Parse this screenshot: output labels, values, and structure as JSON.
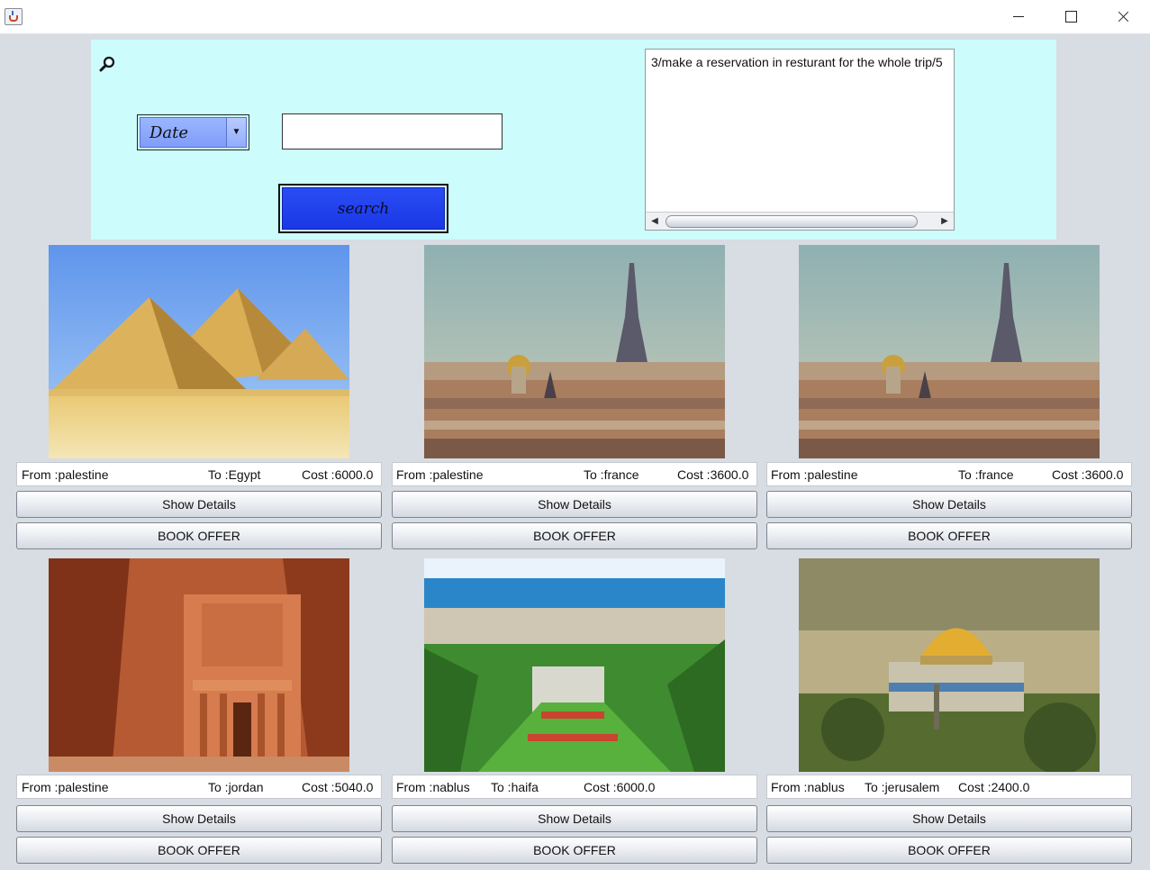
{
  "window": {
    "app_icon": "java-cup-icon",
    "controls": [
      "minimize-icon",
      "maximize-icon",
      "close-icon"
    ]
  },
  "search": {
    "icon": "magnifier-icon",
    "filter_selected": "Date",
    "query_value": "",
    "button_label": "search",
    "notes_text": "3/make a reservation in resturant for the whole trip/5"
  },
  "offers": [
    {
      "image": "pyramids-egypt",
      "from": "From :palestine",
      "to": "To :Egypt",
      "cost": "Cost :6000.0",
      "details_label": "Show Details",
      "book_label": "BOOK OFFER"
    },
    {
      "image": "eiffel-tower-paris",
      "from": "From :palestine",
      "to": "To :france",
      "cost": "Cost :3600.0",
      "details_label": "Show Details",
      "book_label": "BOOK OFFER"
    },
    {
      "image": "eiffel-tower-paris",
      "from": "From :palestine",
      "to": "To :france",
      "cost": "Cost :3600.0",
      "details_label": "Show Details",
      "book_label": "BOOK OFFER"
    },
    {
      "image": "petra-treasury",
      "from": "From :palestine",
      "to": "To :jordan",
      "cost": "Cost :5040.0",
      "details_label": "Show Details",
      "book_label": "BOOK OFFER"
    },
    {
      "image": "haifa-bahai-gardens",
      "from": "From :nablus",
      "to": "To :haifa",
      "cost": "Cost :6000.0",
      "details_label": "Show Details",
      "book_label": "BOOK OFFER"
    },
    {
      "image": "dome-of-the-rock-jerusalem",
      "from": "From :nablus",
      "to": "To :jerusalem",
      "cost": "Cost :2400.0",
      "details_label": "Show Details",
      "book_label": "BOOK OFFER"
    }
  ],
  "colors": {
    "search_panel_bg": "#ccfcfc",
    "search_button": "#1a38e6",
    "combo": "#8fa9fb",
    "window_bg": "#d8dce3"
  }
}
